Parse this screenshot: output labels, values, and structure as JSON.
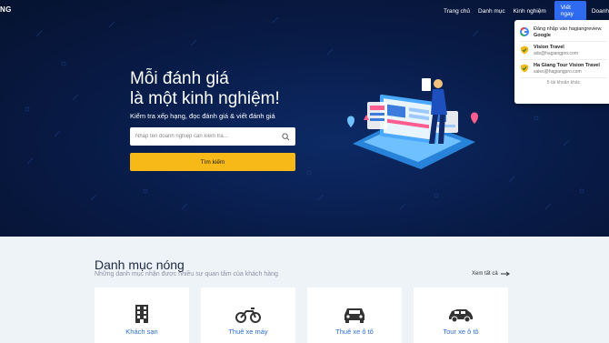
{
  "logo": {
    "text": "NG"
  },
  "nav": {
    "items": [
      "Trang chủ",
      "Danh mục",
      "Kinh nghiệm"
    ],
    "cta": "Viết ngay",
    "cta2": "Doanh"
  },
  "dropdown": {
    "google": {
      "line1": "Đăng nhập vào hagiangreview.",
      "line2": "Google"
    },
    "accounts": [
      {
        "name": "Vision Travel",
        "email": "ads@hagiangpro.com"
      },
      {
        "name": "Ha Giang Tour Vision Travel",
        "email": "sales@hagiangpro.com"
      }
    ],
    "more": "5 tài khoản khác"
  },
  "hero": {
    "headline_line1": "Mỗi đánh giá",
    "headline_line2": "là một kinh nghiệm!",
    "subline": "Kiểm tra xếp hạng, đọc đánh giá & viết đánh giá",
    "search_placeholder": "Nhập tên doanh nghiệp cần kiểm tra...",
    "search_button": "Tìm kiếm"
  },
  "categories": {
    "title": "Danh mục nóng",
    "subtitle": "Những danh mục nhận được nhiều sự quan tâm của khách hàng",
    "see_all": "Xem tất cả",
    "items": [
      {
        "label": "Khách sạn",
        "icon": "building-icon"
      },
      {
        "label": "Thuê xe máy",
        "icon": "motorbike-icon"
      },
      {
        "label": "Thuê xe ô tô",
        "icon": "car-icon"
      },
      {
        "label": "Tour xe ô tô",
        "icon": "suv-icon"
      }
    ]
  },
  "colors": {
    "accent": "#2f6bf0",
    "button": "#f7b918",
    "hero_bg": "#081a45",
    "link": "#2d6fd6"
  }
}
